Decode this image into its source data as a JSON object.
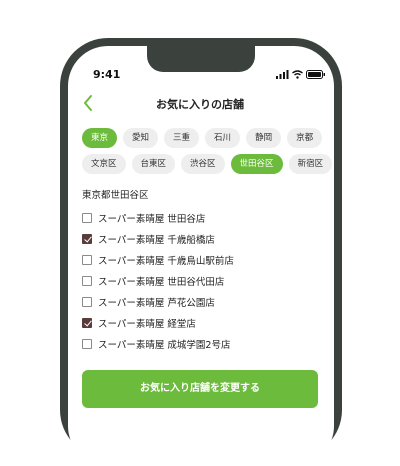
{
  "status": {
    "time": "9:41"
  },
  "header": {
    "title": "お気に入りの店舗"
  },
  "prefecture_chips": [
    {
      "label": "東京",
      "selected": true
    },
    {
      "label": "愛知",
      "selected": false
    },
    {
      "label": "三重",
      "selected": false
    },
    {
      "label": "石川",
      "selected": false
    },
    {
      "label": "静岡",
      "selected": false
    },
    {
      "label": "京都",
      "selected": false
    }
  ],
  "ward_chips": [
    {
      "label": "文京区",
      "selected": false
    },
    {
      "label": "台東区",
      "selected": false
    },
    {
      "label": "渋谷区",
      "selected": false
    },
    {
      "label": "世田谷区",
      "selected": true
    },
    {
      "label": "新宿区",
      "selected": false
    }
  ],
  "section_heading": "東京都世田谷区",
  "stores": [
    {
      "label": "スーパー素晴屋 世田谷店",
      "checked": false
    },
    {
      "label": "スーパー素晴屋 千歳船橋店",
      "checked": true
    },
    {
      "label": "スーパー素晴屋 千歳烏山駅前店",
      "checked": false
    },
    {
      "label": "スーパー素晴屋 世田谷代田店",
      "checked": false
    },
    {
      "label": "スーパー素晴屋 芦花公園店",
      "checked": false
    },
    {
      "label": "スーパー素晴屋 経堂店",
      "checked": true
    },
    {
      "label": "スーパー素晴屋 成城学園2号店",
      "checked": false
    }
  ],
  "cta": {
    "label": "お気に入り店舗を変更する"
  },
  "colors": {
    "accent": "#6cbb3c",
    "check": "#5a3b3b",
    "frame": "#3b423d"
  }
}
